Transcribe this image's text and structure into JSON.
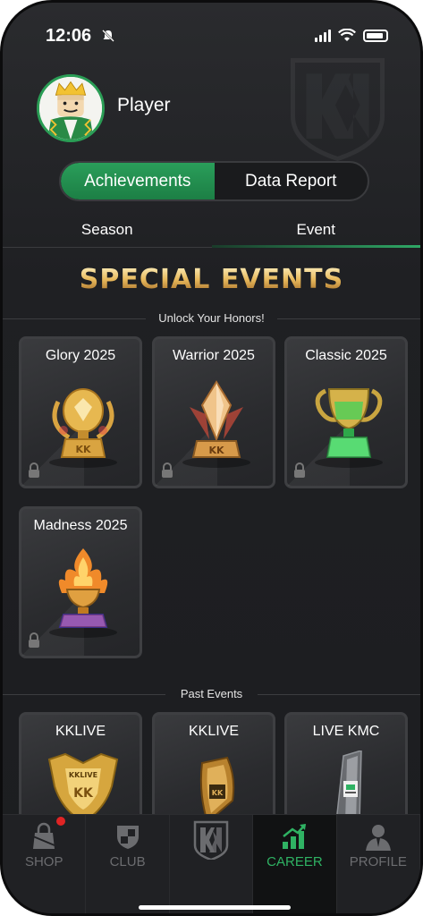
{
  "status": {
    "time": "12:06"
  },
  "profile": {
    "name": "Player"
  },
  "main_tabs": [
    {
      "label": "Achievements",
      "active": true
    },
    {
      "label": "Data Report",
      "active": false
    }
  ],
  "sub_tabs": [
    {
      "label": "Season",
      "active": false
    },
    {
      "label": "Event",
      "active": true
    }
  ],
  "special": {
    "title": "SPECIAL EVENTS",
    "subtitle": "Unlock Your Honors!",
    "cards": [
      {
        "title": "Glory 2025",
        "icon": "glory-trophy",
        "color": "#d9a441",
        "locked": true
      },
      {
        "title": "Warrior 2025",
        "icon": "warrior-trophy",
        "color": "#e8b46a",
        "locked": true
      },
      {
        "title": "Classic 2025",
        "icon": "classic-trophy",
        "color": "#38d45a",
        "locked": true
      },
      {
        "title": "Madness 2025",
        "icon": "madness-trophy",
        "color": "#f08a2a",
        "locked": true
      }
    ]
  },
  "past": {
    "label": "Past Events",
    "cards": [
      {
        "title": "KKLIVE",
        "icon": "kklive-shield-trophy"
      },
      {
        "title": "KKLIVE",
        "icon": "kklive-plaque-trophy"
      },
      {
        "title": "LIVE KMC",
        "icon": "kmc-crystal-trophy"
      }
    ]
  },
  "nav": [
    {
      "label": "SHOP",
      "icon": "shop-bag-icon",
      "badge": true
    },
    {
      "label": "CLUB",
      "icon": "club-shield-icon"
    },
    {
      "label": "",
      "icon": "kk-logo-icon"
    },
    {
      "label": "CAREER",
      "icon": "career-chart-icon",
      "active": true
    },
    {
      "label": "PROFILE",
      "icon": "profile-person-icon"
    }
  ],
  "colors": {
    "accent": "#2fb263",
    "background": "#1f2023",
    "gold": "#e8b95c"
  }
}
